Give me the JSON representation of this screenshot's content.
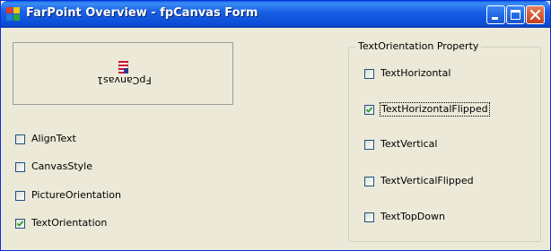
{
  "window": {
    "title": "FarPoint Overview - fpCanvas Form",
    "controls": [
      "minimize",
      "maximize",
      "close"
    ]
  },
  "canvas": {
    "text": "FpCanvas1",
    "icon": "us-flag-icon"
  },
  "left_options": [
    {
      "label": "AlignText",
      "checked": false
    },
    {
      "label": "CanvasStyle",
      "checked": false
    },
    {
      "label": "PictureOrientation",
      "checked": false
    },
    {
      "label": "TextOrientation",
      "checked": true
    }
  ],
  "text_orientation": {
    "title": "TextOrientation Property",
    "options": [
      {
        "label": "TextHorizontal",
        "checked": false
      },
      {
        "label": "TextHorizontalFlipped",
        "checked": true
      },
      {
        "label": "TextVertical",
        "checked": false
      },
      {
        "label": "TextVerticalFlipped",
        "checked": false
      },
      {
        "label": "TextTopDown",
        "checked": false
      }
    ]
  },
  "colors": {
    "titlebar": "#0b4cd6",
    "face": "#ece9d8",
    "close_button": "#d45a34"
  }
}
